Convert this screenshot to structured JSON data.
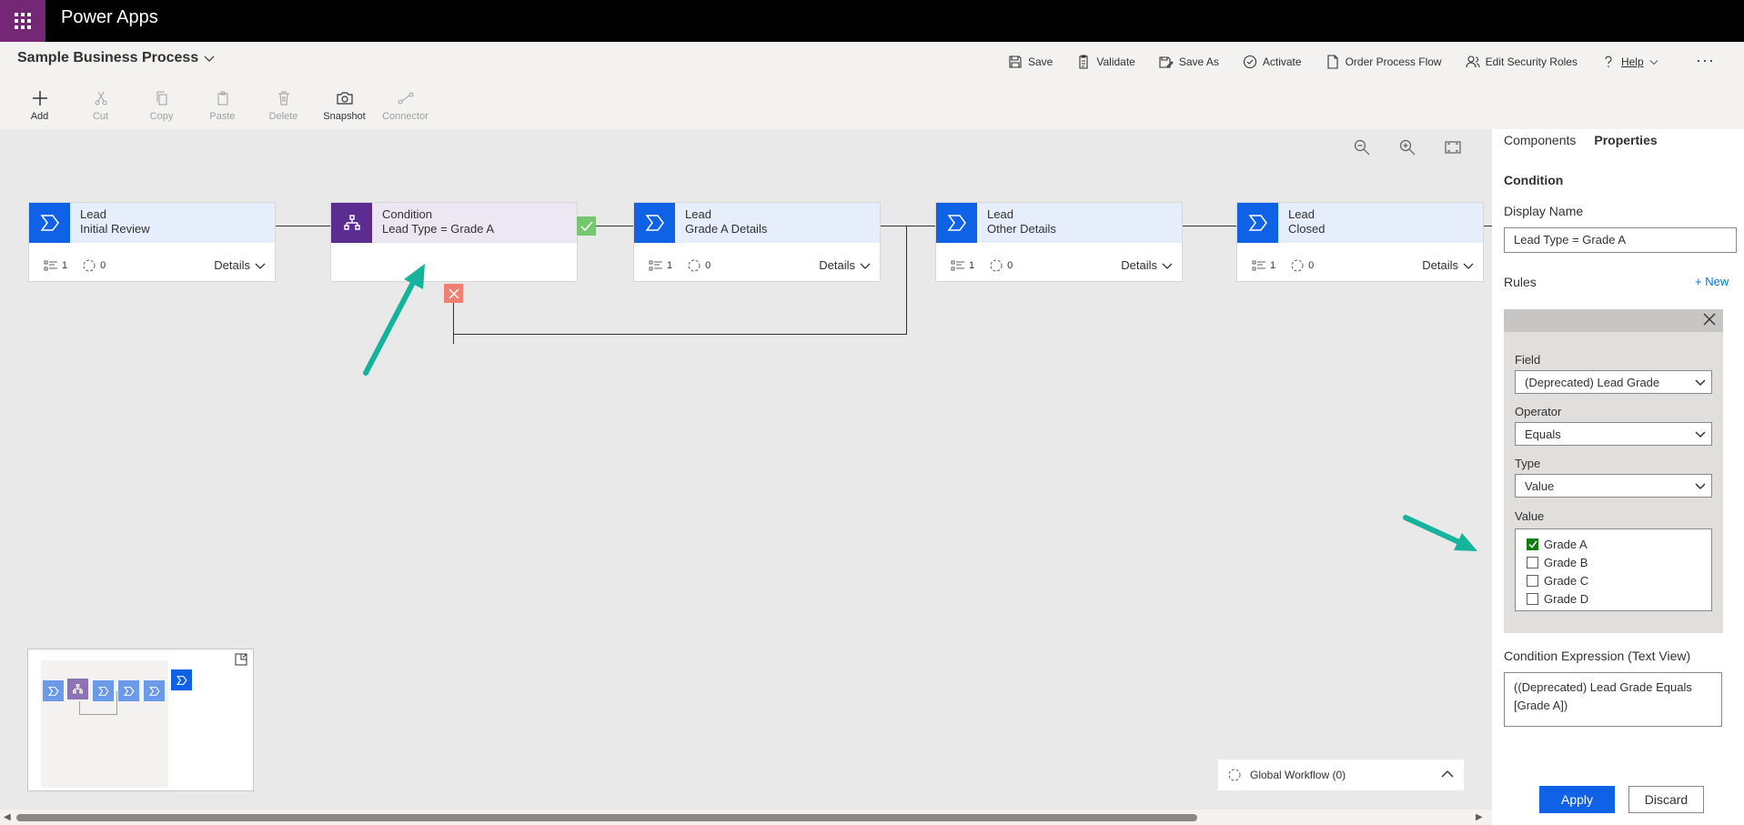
{
  "app": {
    "title": "Power Apps"
  },
  "process": {
    "title": "Sample Business Process"
  },
  "commands": [
    {
      "label": "Save",
      "icon": "save-icon"
    },
    {
      "label": "Validate",
      "icon": "clipboard-check-icon"
    },
    {
      "label": "Save As",
      "icon": "save-as-icon"
    },
    {
      "label": "Activate",
      "icon": "activate-icon"
    },
    {
      "label": "Order Process Flow",
      "icon": "document-icon"
    },
    {
      "label": "Edit Security Roles",
      "icon": "people-icon"
    },
    {
      "label": "Help",
      "icon": "help-icon"
    }
  ],
  "more_label": "···",
  "tools": [
    {
      "label": "Add",
      "enabled": true
    },
    {
      "label": "Cut",
      "enabled": false
    },
    {
      "label": "Copy",
      "enabled": false
    },
    {
      "label": "Paste",
      "enabled": false
    },
    {
      "label": "Delete",
      "enabled": false
    },
    {
      "label": "Snapshot",
      "enabled": true
    },
    {
      "label": "Connector",
      "enabled": false
    }
  ],
  "stages": [
    {
      "entity": "Lead",
      "name": "Initial Review",
      "steps": "1",
      "workflows": "0",
      "details": "Details"
    },
    {
      "entity": "Lead",
      "name": "Grade A Details",
      "steps": "1",
      "workflows": "0",
      "details": "Details"
    },
    {
      "entity": "Lead",
      "name": "Other Details",
      "steps": "1",
      "workflows": "0",
      "details": "Details"
    },
    {
      "entity": "Lead",
      "name": "Closed",
      "steps": "1",
      "workflows": "0",
      "details": "Details"
    }
  ],
  "condition": {
    "title": "Condition",
    "subtitle": "Lead Type = Grade A"
  },
  "global_workflow": {
    "label": "Global Workflow (0)"
  },
  "panel": {
    "tabs": [
      "Components",
      "Properties"
    ],
    "active_tab": "Properties",
    "heading": "Condition",
    "display_name_label": "Display Name",
    "display_name_value": "Lead Type = Grade A",
    "rules_label": "Rules",
    "new_label": "+ New",
    "rule": {
      "field_label": "Field",
      "field_value": "(Deprecated) Lead Grade",
      "operator_label": "Operator",
      "operator_value": "Equals",
      "type_label": "Type",
      "type_value": "Value",
      "value_label": "Value",
      "options": [
        {
          "label": "Grade A",
          "checked": true
        },
        {
          "label": "Grade B",
          "checked": false
        },
        {
          "label": "Grade C",
          "checked": false
        },
        {
          "label": "Grade D",
          "checked": false
        }
      ]
    },
    "expression_label": "Condition Expression (Text View)",
    "expression_value": "((Deprecated) Lead Grade Equals [Grade A])",
    "apply_label": "Apply",
    "discard_label": "Discard"
  },
  "colors": {
    "brand_purple": "#742774",
    "stage_blue": "#0f62e6",
    "condition_purple": "#5c2d91",
    "yes_green": "#75c66f",
    "no_red": "#f08072",
    "annotation_teal": "#15b39b"
  }
}
